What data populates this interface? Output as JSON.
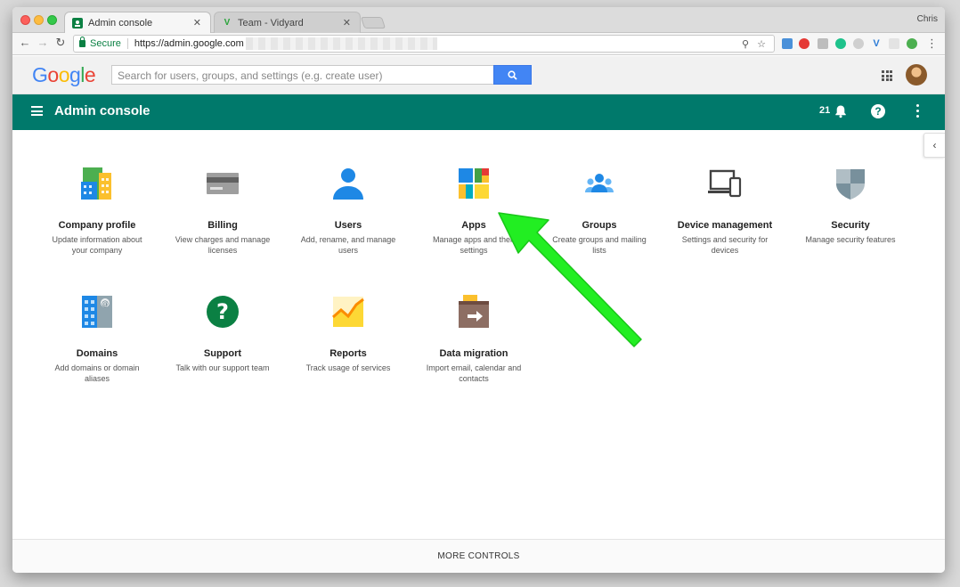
{
  "browser": {
    "tabs": [
      {
        "title": "Admin console",
        "active": true
      },
      {
        "title": "Team - Vidyard",
        "active": false
      }
    ],
    "profile_name": "Chris",
    "secure_label": "Secure",
    "url": "https://admin.google.com"
  },
  "header": {
    "logo": [
      "G",
      "o",
      "o",
      "g",
      "l",
      "e"
    ],
    "logo_colors": [
      "#4285f4",
      "#ea4335",
      "#fbbc05",
      "#4285f4",
      "#34a853",
      "#ea4335"
    ],
    "search_placeholder": "Search for users, groups, and settings (e.g. create user)"
  },
  "adminbar": {
    "title": "Admin console",
    "notification_count": "21",
    "color": "#00796b"
  },
  "tiles": [
    {
      "name": "Company profile",
      "desc": "Update information about your company",
      "icon": "company-profile-icon"
    },
    {
      "name": "Billing",
      "desc": "View charges and manage licenses",
      "icon": "billing-card-icon"
    },
    {
      "name": "Users",
      "desc": "Add, rename, and manage users",
      "icon": "users-person-icon"
    },
    {
      "name": "Apps",
      "desc": "Manage apps and their settings",
      "icon": "apps-grid-icon"
    },
    {
      "name": "Groups",
      "desc": "Create groups and mailing lists",
      "icon": "groups-icon"
    },
    {
      "name": "Device management",
      "desc": "Settings and security for devices",
      "icon": "device-management-icon"
    },
    {
      "name": "Security",
      "desc": "Manage security features",
      "icon": "security-shield-icon"
    },
    {
      "name": "Domains",
      "desc": "Add domains or domain aliases",
      "icon": "domains-icon"
    },
    {
      "name": "Support",
      "desc": "Talk with our support team",
      "icon": "support-question-icon"
    },
    {
      "name": "Reports",
      "desc": "Track usage of services",
      "icon": "reports-chart-icon"
    },
    {
      "name": "Data migration",
      "desc": "Import email, calendar and contacts",
      "icon": "data-migration-icon"
    }
  ],
  "footer": {
    "more_controls": "MORE CONTROLS"
  },
  "annotation_color": "#22ee22"
}
